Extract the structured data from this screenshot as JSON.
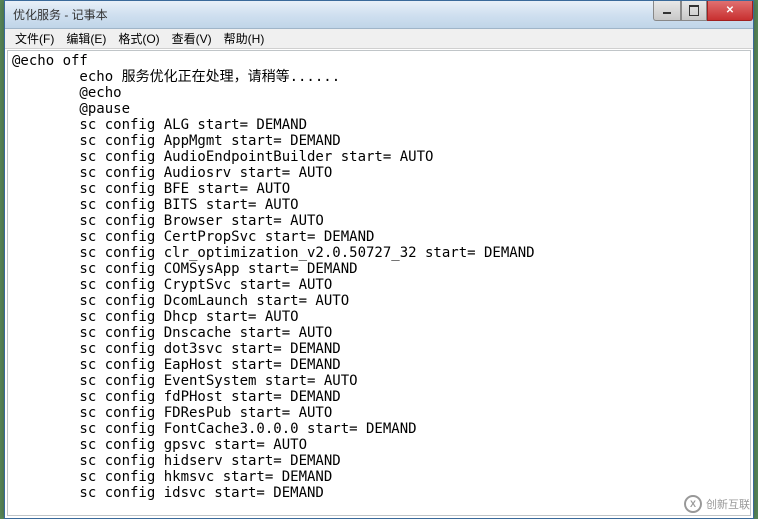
{
  "window": {
    "title": "优化服务 - 记事本"
  },
  "menu": {
    "file": "文件(F)",
    "edit": "编辑(E)",
    "format": "格式(O)",
    "view": "查看(V)",
    "help": "帮助(H)"
  },
  "content_lines": [
    "@echo off",
    "        echo 服务优化正在处理，请稍等......",
    "        @echo",
    "        @pause",
    "        sc config ALG start= DEMAND",
    "        sc config AppMgmt start= DEMAND",
    "        sc config AudioEndpointBuilder start= AUTO",
    "        sc config Audiosrv start= AUTO",
    "        sc config BFE start= AUTO",
    "        sc config BITS start= AUTO",
    "        sc config Browser start= AUTO",
    "        sc config CertPropSvc start= DEMAND",
    "        sc config clr_optimization_v2.0.50727_32 start= DEMAND",
    "        sc config COMSysApp start= DEMAND",
    "        sc config CryptSvc start= AUTO",
    "        sc config DcomLaunch start= AUTO",
    "        sc config Dhcp start= AUTO",
    "        sc config Dnscache start= AUTO",
    "        sc config dot3svc start= DEMAND",
    "        sc config EapHost start= DEMAND",
    "        sc config EventSystem start= AUTO",
    "        sc config fdPHost start= DEMAND",
    "        sc config FDResPub start= AUTO",
    "        sc config FontCache3.0.0.0 start= DEMAND",
    "        sc config gpsvc start= AUTO",
    "        sc config hidserv start= DEMAND",
    "        sc config hkmsvc start= DEMAND",
    "        sc config idsvc start= DEMAND"
  ],
  "watermark": {
    "logo_text": "X",
    "text": "创新互联"
  }
}
